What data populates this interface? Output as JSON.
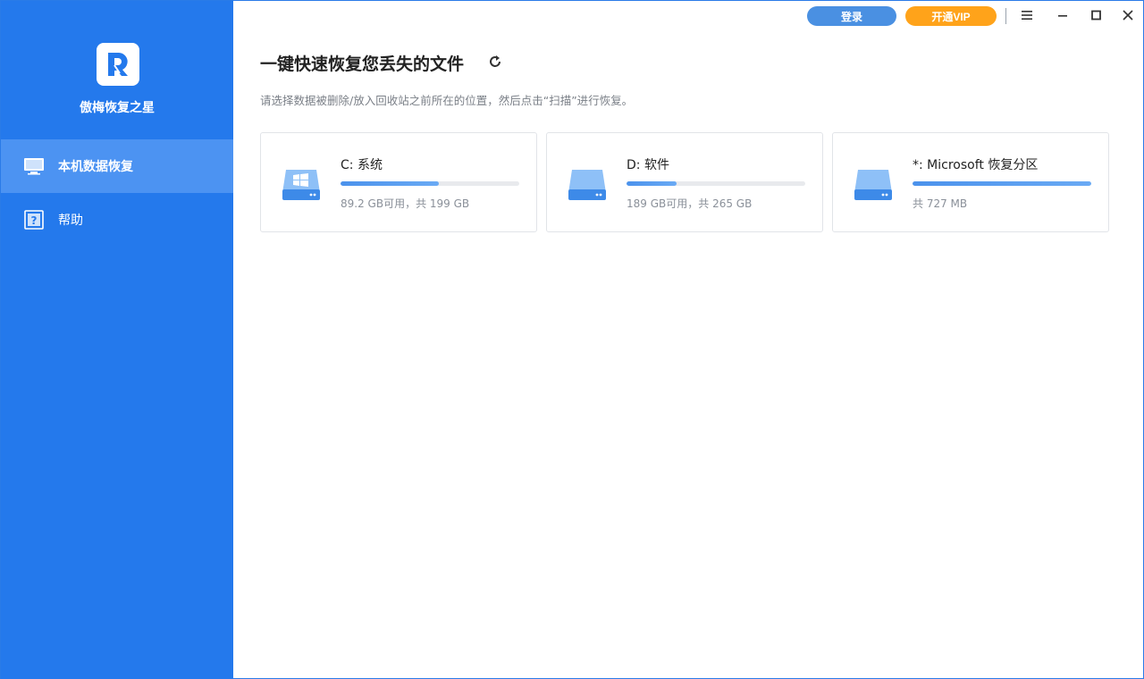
{
  "app": {
    "name": "傲梅恢复之星",
    "colors": {
      "sidebar": "#2479ec",
      "active": "#4c93f2",
      "login": "#4a90e2",
      "vip": "#ffa31a"
    }
  },
  "titlebar": {
    "login_label": "登录",
    "vip_label": "开通VIP"
  },
  "sidebar": {
    "items": [
      {
        "label": "本机数据恢复",
        "icon": "monitor-icon",
        "active": true
      },
      {
        "label": "帮助",
        "icon": "help-icon",
        "active": false
      }
    ]
  },
  "main": {
    "title": "一键快速恢复您丢失的文件",
    "subtitle": "请选择数据被删除/放入回收站之前所在的位置，然后点击“扫描”进行恢复。",
    "drives": [
      {
        "name": "C: 系统",
        "info": "89.2 GB可用，共 199 GB",
        "used_fraction": 0.55,
        "icon": "windows-drive-icon"
      },
      {
        "name": "D: 软件",
        "info": "189 GB可用，共 265 GB",
        "used_fraction": 0.28,
        "icon": "drive-icon"
      },
      {
        "name": "*: Microsoft 恢复分区",
        "info": "共 727 MB",
        "used_fraction": 1.0,
        "icon": "drive-icon"
      }
    ]
  }
}
